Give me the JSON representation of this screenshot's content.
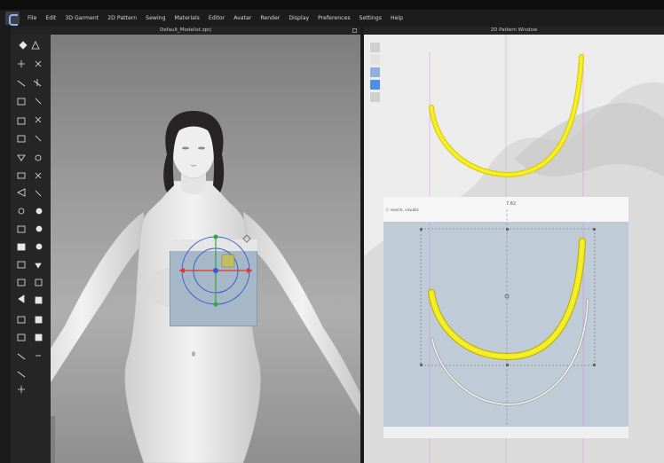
{
  "menubar": {
    "items": [
      "File",
      "Edit",
      "3D Garment",
      "2D Pattern",
      "Sewing",
      "Materials",
      "Editor",
      "Avatar",
      "Render",
      "Display",
      "Preferences",
      "Settings",
      "Help"
    ]
  },
  "panels": {
    "left_title": "Default_Modelist.zprj",
    "right_title": "2D Pattern Window"
  },
  "pattern_view": {
    "inset_label": "ⓐ search, visualiz",
    "inset_value": "7.82"
  },
  "icons": {
    "app_logo": "clo-logo-icon",
    "left_tools": [
      "select-icon",
      "move-icon",
      "transform-icon",
      "sew-icon",
      "pin-icon",
      "fold-icon",
      "measure-icon",
      "avatar-icon",
      "fabric-icon",
      "simulate-icon"
    ],
    "pattern_tools": [
      "pattern-select-icon",
      "edit-point-icon",
      "curve-icon",
      "sewing-icon",
      "segment-icon"
    ]
  },
  "colors": {
    "pattern_yellow": "#f2ec1f",
    "guide_pink": "#ee77dd",
    "gizmo_red": "#e8322a",
    "gizmo_green": "#2ea83a",
    "gizmo_blue": "#3a5ad8"
  }
}
